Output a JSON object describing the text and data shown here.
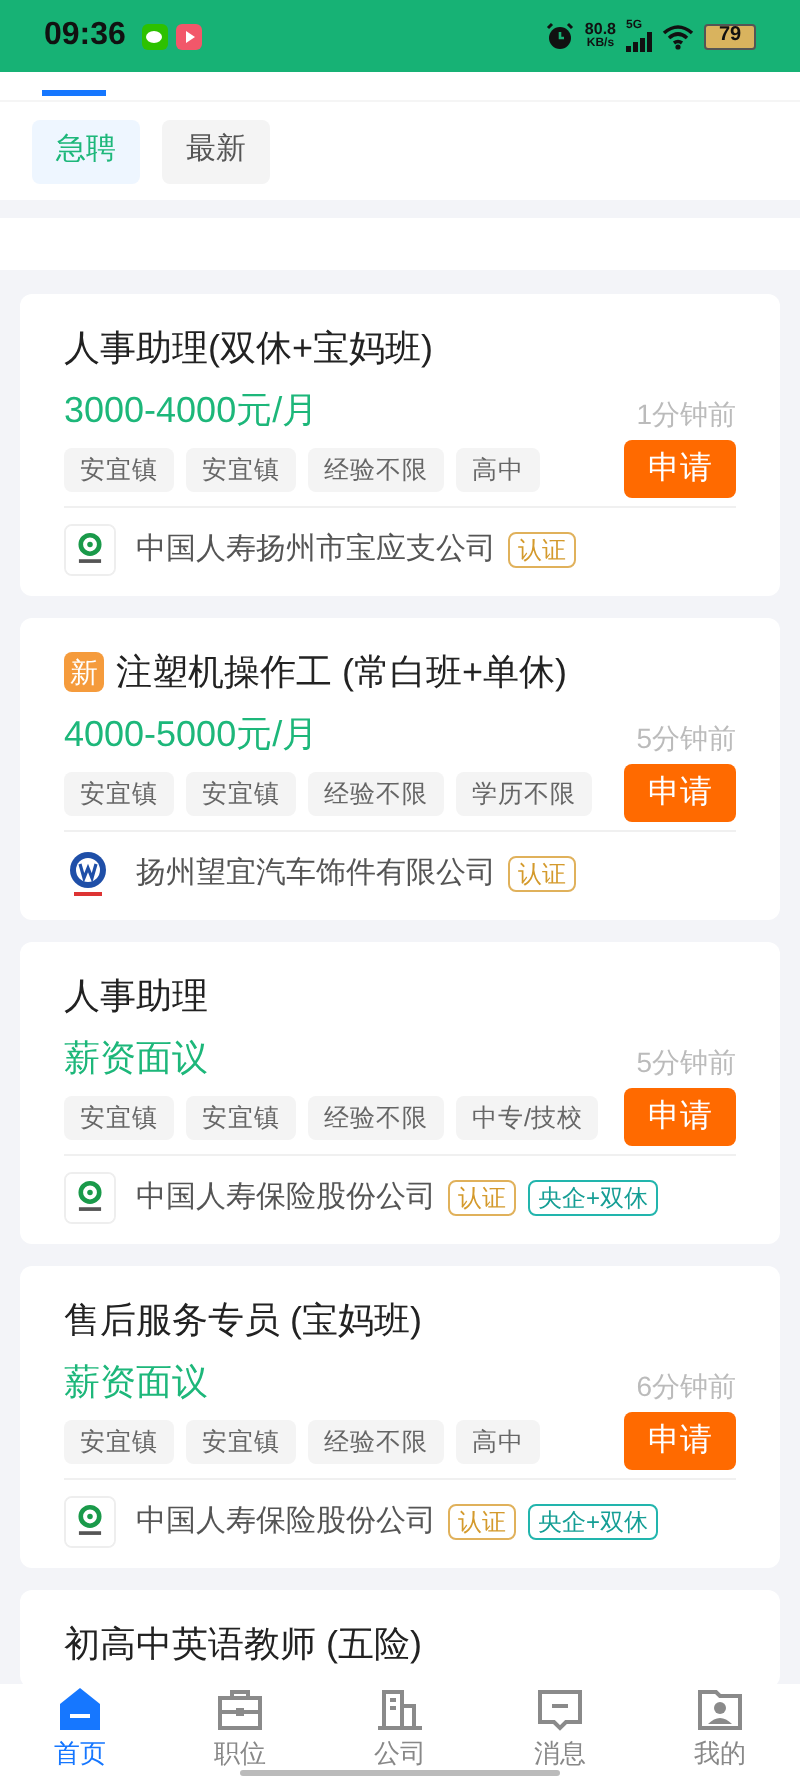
{
  "status_bar": {
    "time": "09:36",
    "net_speed": "80.8",
    "net_unit": "KB/s",
    "network": "5G",
    "battery": "79"
  },
  "filters": [
    {
      "label": "急聘",
      "selected": true
    },
    {
      "label": "最新",
      "selected": false
    }
  ],
  "jobs": [
    {
      "title": "人事助理(双休+宝妈班)",
      "new": false,
      "salary": "3000-4000元/月",
      "time": "1分钟前",
      "tags": [
        "安宜镇",
        "安宜镇",
        "经验不限",
        "高中"
      ],
      "apply": "申请",
      "company": "中国人寿扬州市宝应支公司",
      "logo": {
        "kind": "ring"
      },
      "badges": [
        {
          "text": "认证",
          "kind": "verified"
        }
      ]
    },
    {
      "title": "注塑机操作工 (常白班+单休)",
      "new": true,
      "new_label": "新",
      "salary": "4000-5000元/月",
      "time": "5分钟前",
      "tags": [
        "安宜镇",
        "安宜镇",
        "经验不限",
        "学历不限"
      ],
      "apply": "申请",
      "company": "扬州望宜汽车饰件有限公司",
      "logo": {
        "kind": "emblem"
      },
      "badges": [
        {
          "text": "认证",
          "kind": "verified"
        }
      ]
    },
    {
      "title": "人事助理",
      "new": false,
      "salary": "薪资面议",
      "time": "5分钟前",
      "tags": [
        "安宜镇",
        "安宜镇",
        "经验不限",
        "中专/技校"
      ],
      "apply": "申请",
      "company": "中国人寿保险股份公司",
      "logo": {
        "kind": "ring"
      },
      "badges": [
        {
          "text": "认证",
          "kind": "verified"
        },
        {
          "text": "央企+双休",
          "kind": "feature"
        }
      ]
    },
    {
      "title": "售后服务专员 (宝妈班)",
      "new": false,
      "salary": "薪资面议",
      "time": "6分钟前",
      "tags": [
        "安宜镇",
        "安宜镇",
        "经验不限",
        "高中"
      ],
      "apply": "申请",
      "company": "中国人寿保险股份公司",
      "logo": {
        "kind": "ring"
      },
      "badges": [
        {
          "text": "认证",
          "kind": "verified"
        },
        {
          "text": "央企+双休",
          "kind": "feature"
        }
      ]
    },
    {
      "title": "初高中英语教师 (五险)",
      "new": false
    }
  ],
  "nav": [
    {
      "label": "首页",
      "kind": "home",
      "selected": true
    },
    {
      "label": "职位",
      "kind": "briefcase",
      "selected": false
    },
    {
      "label": "公司",
      "kind": "building",
      "selected": false
    },
    {
      "label": "消息",
      "kind": "message",
      "selected": false
    },
    {
      "label": "我的",
      "kind": "profile",
      "selected": false
    }
  ]
}
